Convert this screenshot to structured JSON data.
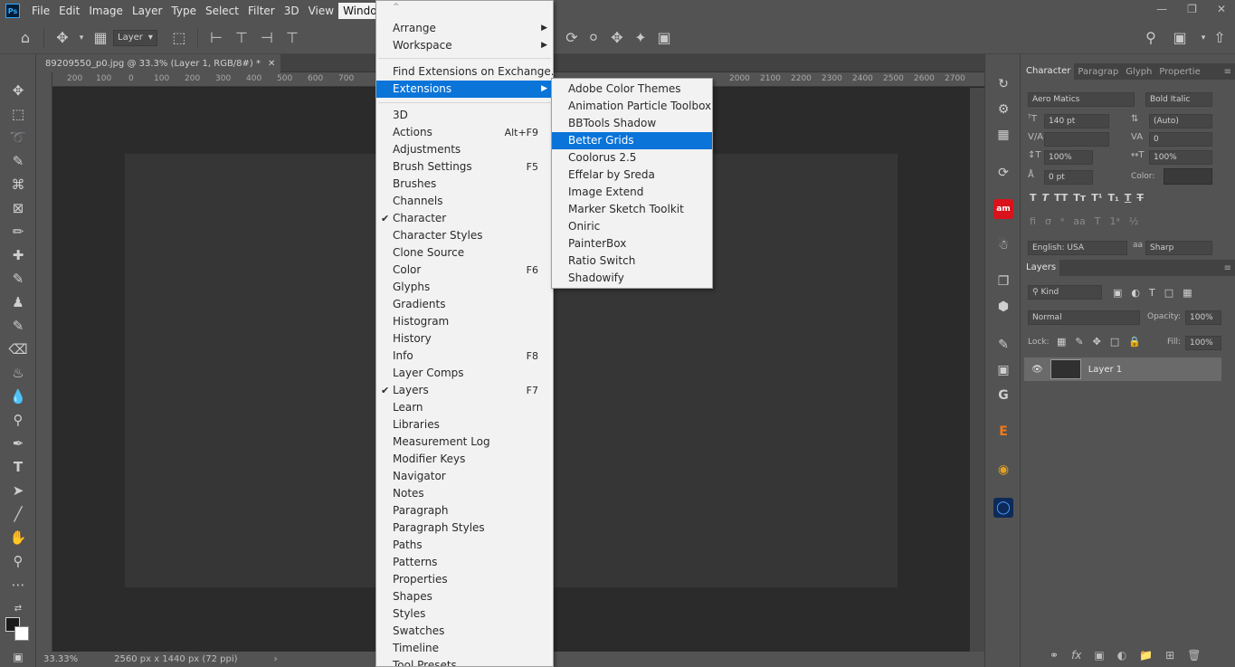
{
  "menubar": {
    "logo": "Ps",
    "items": [
      "File",
      "Edit",
      "Image",
      "Layer",
      "Type",
      "Select",
      "Filter",
      "3D",
      "View",
      "Window"
    ],
    "active": "Window"
  },
  "optionsbar": {
    "layer_select": "Layer"
  },
  "document": {
    "tab_title": "89209550_p0.jpg @ 33.3% (Layer 1, RGB/8#) *",
    "ruler_h": [
      "200",
      "100",
      "0",
      "100",
      "200",
      "300",
      "400",
      "500",
      "600",
      "700",
      "2000",
      "2100",
      "2200",
      "2300",
      "2400",
      "2500",
      "2600",
      "2700"
    ],
    "zoom": "33.33%",
    "dimensions": "2560 px x 1440 px (72 ppi)"
  },
  "window_menu": {
    "top_arrow": "^",
    "items": [
      {
        "label": "Arrange",
        "shortcut": "",
        "submenu": true,
        "checked": false,
        "highlight": false
      },
      {
        "label": "Workspace",
        "shortcut": "",
        "submenu": true,
        "checked": false,
        "highlight": false
      },
      {
        "label": "Find Extensions on Exchange...",
        "shortcut": "",
        "submenu": false,
        "checked": false,
        "highlight": false
      },
      {
        "label": "Extensions",
        "shortcut": "",
        "submenu": true,
        "checked": false,
        "highlight": true
      },
      {
        "label": "3D",
        "shortcut": "",
        "submenu": false,
        "checked": false,
        "highlight": false
      },
      {
        "label": "Actions",
        "shortcut": "Alt+F9",
        "submenu": false,
        "checked": false,
        "highlight": false
      },
      {
        "label": "Adjustments",
        "shortcut": "",
        "submenu": false,
        "checked": false,
        "highlight": false
      },
      {
        "label": "Brush Settings",
        "shortcut": "F5",
        "submenu": false,
        "checked": false,
        "highlight": false
      },
      {
        "label": "Brushes",
        "shortcut": "",
        "submenu": false,
        "checked": false,
        "highlight": false
      },
      {
        "label": "Channels",
        "shortcut": "",
        "submenu": false,
        "checked": false,
        "highlight": false
      },
      {
        "label": "Character",
        "shortcut": "",
        "submenu": false,
        "checked": true,
        "highlight": false
      },
      {
        "label": "Character Styles",
        "shortcut": "",
        "submenu": false,
        "checked": false,
        "highlight": false
      },
      {
        "label": "Clone Source",
        "shortcut": "",
        "submenu": false,
        "checked": false,
        "highlight": false
      },
      {
        "label": "Color",
        "shortcut": "F6",
        "submenu": false,
        "checked": false,
        "highlight": false
      },
      {
        "label": "Glyphs",
        "shortcut": "",
        "submenu": false,
        "checked": false,
        "highlight": false
      },
      {
        "label": "Gradients",
        "shortcut": "",
        "submenu": false,
        "checked": false,
        "highlight": false
      },
      {
        "label": "Histogram",
        "shortcut": "",
        "submenu": false,
        "checked": false,
        "highlight": false
      },
      {
        "label": "History",
        "shortcut": "",
        "submenu": false,
        "checked": false,
        "highlight": false
      },
      {
        "label": "Info",
        "shortcut": "F8",
        "submenu": false,
        "checked": false,
        "highlight": false
      },
      {
        "label": "Layer Comps",
        "shortcut": "",
        "submenu": false,
        "checked": false,
        "highlight": false
      },
      {
        "label": "Layers",
        "shortcut": "F7",
        "submenu": false,
        "checked": true,
        "highlight": false
      },
      {
        "label": "Learn",
        "shortcut": "",
        "submenu": false,
        "checked": false,
        "highlight": false
      },
      {
        "label": "Libraries",
        "shortcut": "",
        "submenu": false,
        "checked": false,
        "highlight": false
      },
      {
        "label": "Measurement Log",
        "shortcut": "",
        "submenu": false,
        "checked": false,
        "highlight": false
      },
      {
        "label": "Modifier Keys",
        "shortcut": "",
        "submenu": false,
        "checked": false,
        "highlight": false
      },
      {
        "label": "Navigator",
        "shortcut": "",
        "submenu": false,
        "checked": false,
        "highlight": false
      },
      {
        "label": "Notes",
        "shortcut": "",
        "submenu": false,
        "checked": false,
        "highlight": false
      },
      {
        "label": "Paragraph",
        "shortcut": "",
        "submenu": false,
        "checked": false,
        "highlight": false
      },
      {
        "label": "Paragraph Styles",
        "shortcut": "",
        "submenu": false,
        "checked": false,
        "highlight": false
      },
      {
        "label": "Paths",
        "shortcut": "",
        "submenu": false,
        "checked": false,
        "highlight": false
      },
      {
        "label": "Patterns",
        "shortcut": "",
        "submenu": false,
        "checked": false,
        "highlight": false
      },
      {
        "label": "Properties",
        "shortcut": "",
        "submenu": false,
        "checked": false,
        "highlight": false
      },
      {
        "label": "Shapes",
        "shortcut": "",
        "submenu": false,
        "checked": false,
        "highlight": false
      },
      {
        "label": "Styles",
        "shortcut": "",
        "submenu": false,
        "checked": false,
        "highlight": false
      },
      {
        "label": "Swatches",
        "shortcut": "",
        "submenu": false,
        "checked": false,
        "highlight": false
      },
      {
        "label": "Timeline",
        "shortcut": "",
        "submenu": false,
        "checked": false,
        "highlight": false
      },
      {
        "label": "Tool Presets",
        "shortcut": "",
        "submenu": false,
        "checked": false,
        "highlight": false
      }
    ]
  },
  "extensions_menu": {
    "items": [
      {
        "label": "Adobe Color Themes",
        "highlight": false
      },
      {
        "label": "Animation Particle Toolbox",
        "highlight": false
      },
      {
        "label": "BBTools Shadow",
        "highlight": false
      },
      {
        "label": "Better Grids",
        "highlight": true
      },
      {
        "label": "Coolorus 2.5",
        "highlight": false
      },
      {
        "label": "Effelar by Sreda",
        "highlight": false
      },
      {
        "label": "Image Extend",
        "highlight": false
      },
      {
        "label": "Marker Sketch Toolkit",
        "highlight": false
      },
      {
        "label": "Oniric",
        "highlight": false
      },
      {
        "label": "PainterBox",
        "highlight": false
      },
      {
        "label": "Ratio Switch",
        "highlight": false
      },
      {
        "label": "Shadowify",
        "highlight": false
      }
    ]
  },
  "character_panel": {
    "tabs": [
      "Character",
      "Paragrap",
      "Glyph",
      "Propertie"
    ],
    "font_family": "Aero Matics",
    "font_style": "Bold Italic",
    "font_size": "140 pt",
    "leading": "(Auto)",
    "tracking": "0",
    "vscale": "100%",
    "hscale": "100%",
    "baseline": "0 pt",
    "color_label": "Color:",
    "language": "English: USA",
    "antialias": "Sharp"
  },
  "layers_panel": {
    "title": "Layers",
    "kind": "Kind",
    "blend": "Normal",
    "opacity_label": "Opacity:",
    "opacity": "100%",
    "lock_label": "Lock:",
    "fill_label": "Fill:",
    "fill": "100%",
    "layer_name": "Layer 1"
  },
  "colors": {
    "highlight": "#0a74d9",
    "ui_bg": "#535353",
    "canvas_bg": "#282828"
  }
}
